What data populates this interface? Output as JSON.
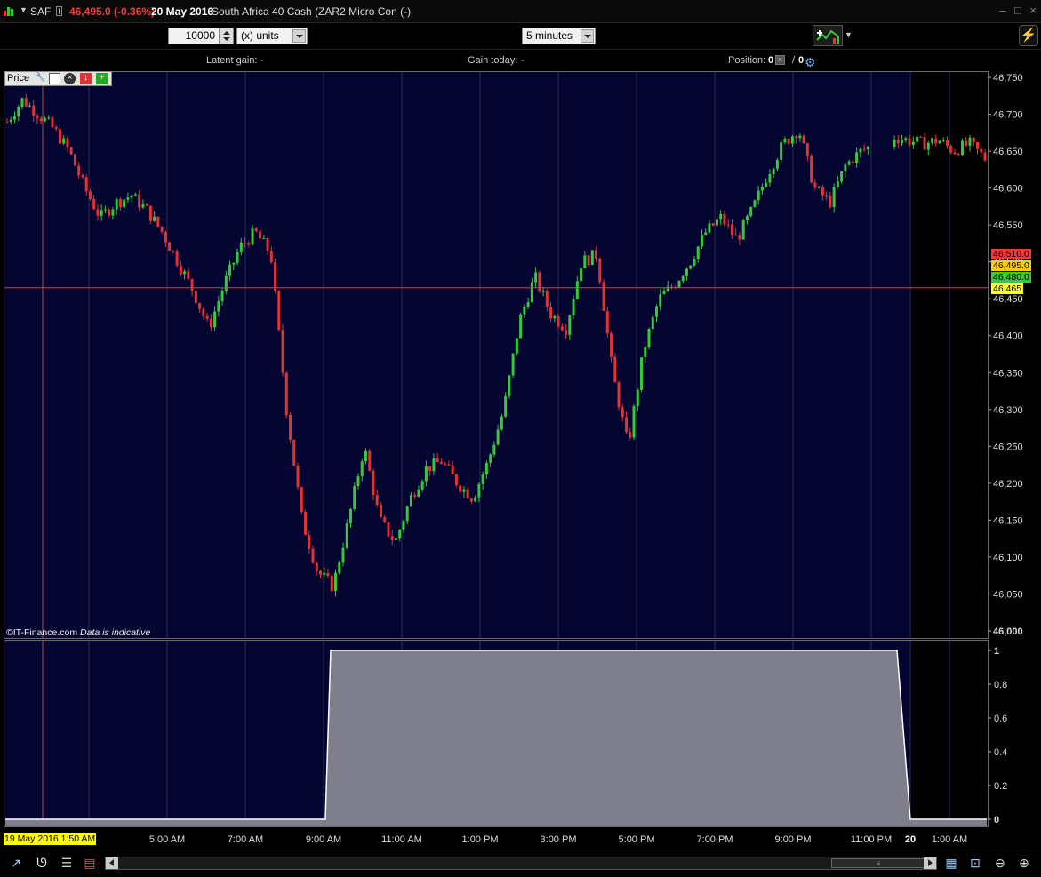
{
  "titlebar": {
    "menu_arrow": "▼",
    "symbol": "SAF",
    "price_change": "46,495.0 (-0.36%)",
    "date": "20 May 2016",
    "instrument": "South Africa 40 Cash (ZAR2 Micro Con (-)",
    "window_buttons": [
      "–",
      "□",
      "×"
    ]
  },
  "toolbar": {
    "quantity": "10000",
    "unit": "(x) units",
    "interval": "5 minutes"
  },
  "infobar": {
    "latent_gain_label": "Latent gain:",
    "latent_gain_value": "-",
    "gain_today_label": "Gain today:",
    "gain_today_value": "-",
    "position_label": "Position:",
    "position_left": "0",
    "position_sep": "/",
    "position_right": "0"
  },
  "price_panel": {
    "label": "Price",
    "icons": [
      "wrench-icon",
      "window-icon",
      "close-icon",
      "export-icon",
      "new-window-icon"
    ]
  },
  "credit": {
    "source": "©IT-Finance.com",
    "note": "Data is indicative"
  },
  "price_tags": [
    {
      "text": "46,510.0",
      "bg": "#ff3333"
    },
    {
      "text": "46,495.0",
      "bg": "#ffcc00"
    },
    {
      "text": "46,480.0",
      "bg": "#33cc33"
    },
    {
      "text": "46,465",
      "bg": "#ffff33"
    }
  ],
  "date_highlight": "19 May 2016 1:50 AM",
  "colors": {
    "plot_bg": "#040430",
    "session_after": "#000000",
    "up_candle": "#36c837",
    "down_candle": "#e23232",
    "crosshair": "#c04848",
    "area_fill": "#7e7e8c",
    "area_line": "#ffffff"
  },
  "chart_data": [
    {
      "type": "candlestick",
      "title": "Price",
      "ylim": [
        46000,
        46750
      ],
      "y_ticks": [
        "46,750",
        "46,700",
        "46,650",
        "46,600",
        "46,550",
        "46,500",
        "46,450",
        "46,400",
        "46,350",
        "46,300",
        "46,250",
        "46,200",
        "46,150",
        "46,100",
        "46,050",
        "46,000"
      ],
      "crosshair_y": 46465,
      "session_end_x_label": "20",
      "series": [
        {
          "values": [
            46690,
            46720,
            46700,
            46680,
            46650,
            46600,
            46560,
            46580,
            46590,
            46570,
            46540,
            46500,
            46460,
            46410,
            46470,
            46520,
            46540,
            46510,
            46300,
            46150,
            46080,
            46060,
            46150,
            46250,
            46150,
            46120,
            46180,
            46220,
            46230,
            46200,
            46180,
            46230,
            46300,
            46420,
            46480,
            46430,
            46410,
            46500,
            46510,
            46350,
            46250,
            46380,
            46450,
            46470,
            46500,
            46540,
            46560,
            46530,
            46570,
            46620,
            46660,
            46680,
            46600,
            46580,
            46630,
            46650,
            46660,
            46670,
            46665,
            46660,
            46665,
            46650,
            46660,
            46640
          ]
        }
      ]
    },
    {
      "type": "area",
      "title": "",
      "ylim": [
        0,
        1
      ],
      "y_ticks": [
        "1",
        "0.8",
        "0.6",
        "0.4",
        "0.2",
        "0"
      ],
      "segments": [
        {
          "from": "before 9:00 AM",
          "value": 0
        },
        {
          "from": "9:00 AM",
          "to": "11:00 PM",
          "value": 1
        },
        {
          "from": "after 11:00 PM",
          "value": 0
        }
      ]
    }
  ],
  "x_ticks": [
    "AM",
    "5:00 AM",
    "7:00 AM",
    "9:00 AM",
    "11:00 AM",
    "1:00 PM",
    "3:00 PM",
    "5:00 PM",
    "7:00 PM",
    "9:00 PM",
    "11:00 PM",
    "20",
    "1:00 AM"
  ],
  "bottombar": {
    "icons": [
      "cursor-icon",
      "magnet-icon",
      "list-icon",
      "layers-icon",
      "scroll-thumb-icon",
      "bars-icon",
      "zoom-fit-icon",
      "zoom-out-icon",
      "zoom-in-icon"
    ]
  }
}
